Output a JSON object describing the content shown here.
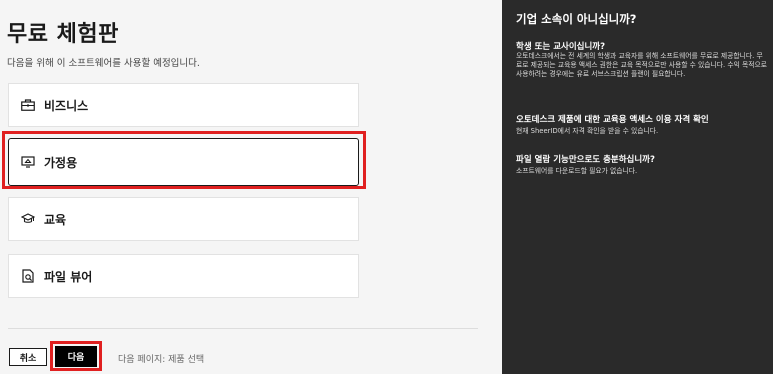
{
  "main": {
    "title": "무료 체험판",
    "subtitle": "다음을 위해 이 소프트웨어를 사용할 예정입니다.",
    "options": [
      {
        "label": "비즈니스",
        "icon": "briefcase-icon"
      },
      {
        "label": "가정용",
        "icon": "home-icon",
        "selected": true
      },
      {
        "label": "교육",
        "icon": "graduation-cap-icon"
      },
      {
        "label": "파일 뷰어",
        "icon": "file-viewer-icon"
      }
    ]
  },
  "footer": {
    "cancel_label": "취소",
    "next_label": "다음",
    "next_page_info": "다음 페이지: 제품 선택"
  },
  "sidebar": {
    "title": "기업 소속이 아니십니까?",
    "sections": [
      {
        "heading": "학생 또는 교사이십니까?",
        "body": "오토데스크에서는 전 세계의 학생과 교육자를 위해 소프트웨어를 무료로 제공합니다. 무료로 제공되는 교육용 액세스 권한은 교육 목적으로만 사용할 수 있습니다. 수익 목적으로 사용하려는 경우에는 유료 서브스크립션 플랜이 필요합니다."
      },
      {
        "heading": "오토데스크 제품에 대한 교육용 액세스 이용 자격 확인",
        "body": "현재 SheerID에서 자격 확인을 받을 수 있습니다."
      },
      {
        "heading": "파일 열람 기능만으로도 충분하십니까?",
        "body": "소프트웨어를 다운로드할 필요가 없습니다."
      }
    ]
  },
  "colors": {
    "highlight": "#e02020",
    "sidebar_bg": "#2a2a2a",
    "primary_button": "#000000"
  }
}
